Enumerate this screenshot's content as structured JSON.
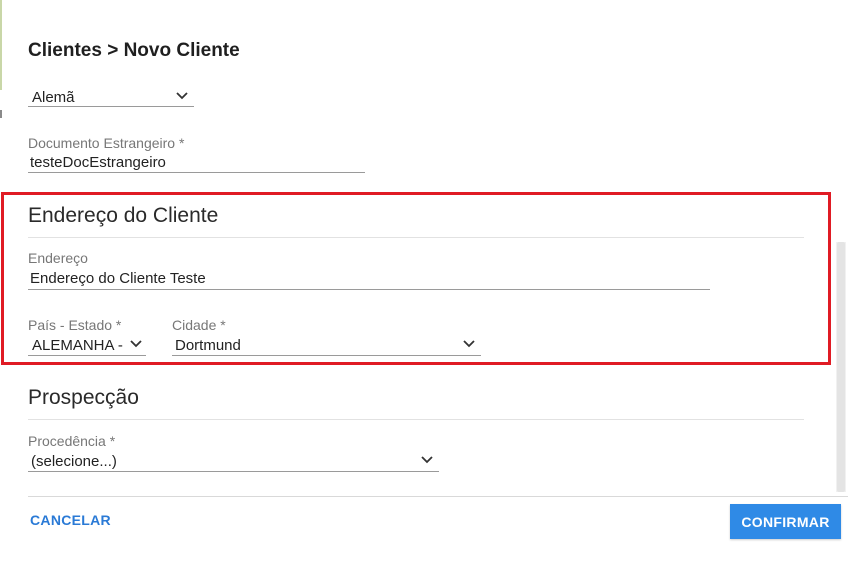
{
  "header": {
    "title": "Clientes > Novo Cliente"
  },
  "nationality": {
    "value": "Alemã"
  },
  "foreign_document": {
    "label": "Documento Estrangeiro *",
    "value": "testeDocEstrangeiro"
  },
  "address_section": {
    "title": "Endereço do Cliente",
    "address": {
      "label": "Endereço",
      "value": "Endereço do Cliente Teste"
    },
    "country_state": {
      "label": "País - Estado *",
      "value": "ALEMANHA -"
    },
    "city": {
      "label": "Cidade *",
      "value": "Dortmund"
    }
  },
  "prospect_section": {
    "title": "Prospecção",
    "origin": {
      "label": "Procedência *",
      "value": "(selecione...)"
    }
  },
  "footer": {
    "cancel_label": "CANCELAR",
    "confirm_label": "CONFIRMAR"
  },
  "colors": {
    "accent": "#2f8ae6",
    "highlight": "#e01b24",
    "link": "#2a7ad6"
  }
}
